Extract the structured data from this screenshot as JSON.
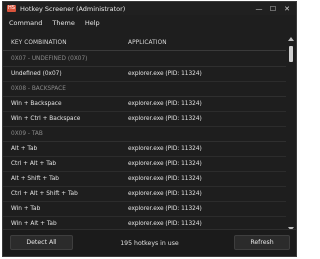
{
  "window": {
    "title": "Hotkey Screener (Administrator)",
    "app_icon_glyph": "HS",
    "controls": {
      "minimize": "—",
      "maximize": "☐",
      "close": "✕"
    }
  },
  "menu": [
    "Command",
    "Theme",
    "Help"
  ],
  "table": {
    "columns": [
      "KEY COMBINATION",
      "APPLICATION"
    ],
    "groups": [
      {
        "label": "0X07 - UNDEFINED (0X07)",
        "rows": [
          {
            "keys": "Undefined (0x07)",
            "app": "explorer.exe (PID: 11324)"
          }
        ]
      },
      {
        "label": "0X08 - BACKSPACE",
        "rows": [
          {
            "keys": "Win + Backspace",
            "app": "explorer.exe (PID: 11324)"
          },
          {
            "keys": "Win + Ctrl + Backspace",
            "app": "explorer.exe (PID: 11324)"
          }
        ]
      },
      {
        "label": "0X09 - TAB",
        "rows": [
          {
            "keys": "Alt + Tab",
            "app": "explorer.exe (PID: 11324)"
          },
          {
            "keys": "Ctrl + Alt + Tab",
            "app": "explorer.exe (PID: 11324)"
          },
          {
            "keys": "Alt + Shift + Tab",
            "app": "explorer.exe (PID: 11324)"
          },
          {
            "keys": "Ctrl + Alt + Shift + Tab",
            "app": "explorer.exe (PID: 11324)"
          },
          {
            "keys": "Win + Tab",
            "app": "explorer.exe (PID: 11324)"
          },
          {
            "keys": "Win + Alt + Tab",
            "app": "explorer.exe (PID: 11324)"
          }
        ]
      }
    ]
  },
  "footer": {
    "detect_label": "Detect All",
    "status": "195 hotkeys in use",
    "refresh_label": "Refresh"
  }
}
